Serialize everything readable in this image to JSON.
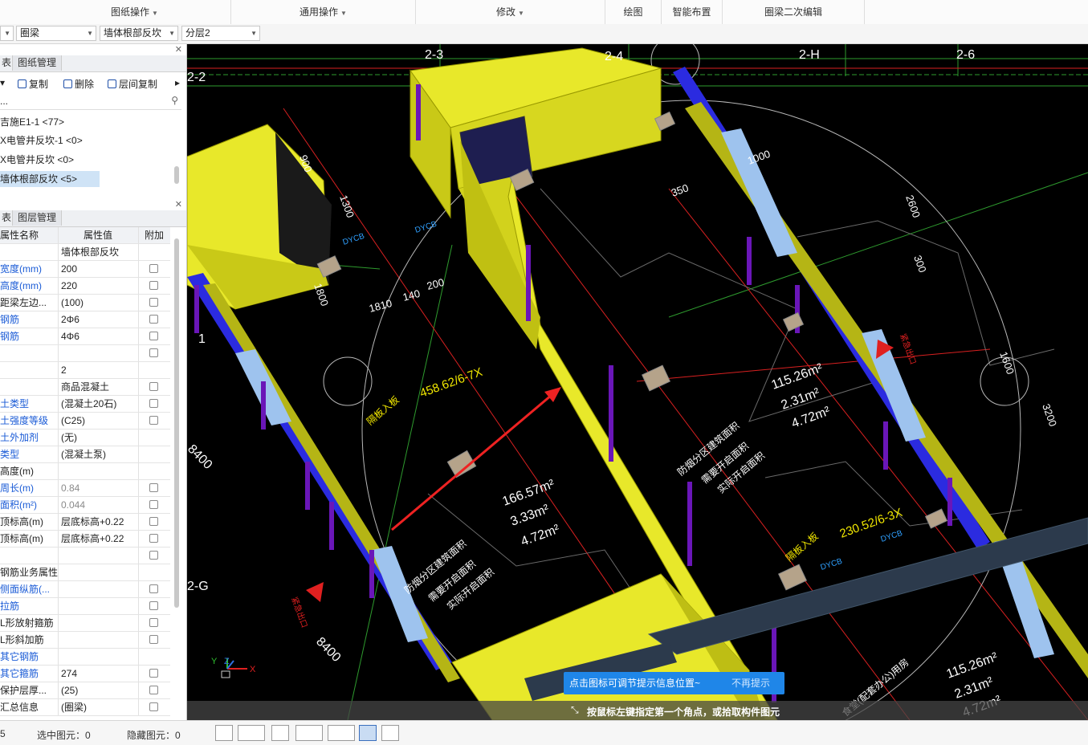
{
  "ribbon": {
    "groups": [
      {
        "label": "图纸操作",
        "dropdown": true
      },
      {
        "label": "通用操作",
        "dropdown": true
      },
      {
        "label": "修改",
        "dropdown": true
      },
      {
        "label": "绘图",
        "dropdown": false
      },
      {
        "label": "智能布置",
        "dropdown": false
      },
      {
        "label": "圈梁二次编辑",
        "dropdown": false
      }
    ]
  },
  "selectors": {
    "element_type": "圈梁",
    "element_name": "墙体根部反坎",
    "layer": "分层2"
  },
  "upper_panel": {
    "tab_left_partial": "表",
    "tab_drawing": "图纸管理",
    "toolbar": {
      "copy": "复制",
      "delete": "删除",
      "floor_copy": "层间复制"
    },
    "filter_placeholder": "...",
    "items": [
      {
        "label": "结施E1-1 <77>",
        "visible": "吉施E1-1 <77>"
      },
      {
        "label": "X电管井反坎-1 <0>",
        "visible": "X电管井反坎-1 <0>"
      },
      {
        "label": "X电管井反坎 <0>",
        "visible": "X电管井反坎 <0>"
      },
      {
        "label": "墙体根部反坎 <5>",
        "visible": "墙体根部反坎 <5>"
      }
    ]
  },
  "lower_panel": {
    "tab_left_partial": "表",
    "tab_layers": "图层管理",
    "header": {
      "name": "属性名称",
      "value": "属性值",
      "extra": "附加"
    },
    "rows": [
      {
        "name": "",
        "value": "墙体根部反坎",
        "cb": false,
        "style": ""
      },
      {
        "name": "宽度(mm)",
        "value": "200",
        "cb": true,
        "style": "blue"
      },
      {
        "name": "高度(mm)",
        "value": "220",
        "cb": true,
        "style": "blue"
      },
      {
        "name": "距梁左边...",
        "value": "(100)",
        "cb": true,
        "style": ""
      },
      {
        "name": "钢筋",
        "value": "2Φ6",
        "cb": true,
        "style": "blue"
      },
      {
        "name": "钢筋",
        "value": "4Φ6",
        "cb": true,
        "style": "blue"
      },
      {
        "name": "",
        "value": "",
        "cb": true,
        "style": ""
      },
      {
        "name": "",
        "value": "2",
        "cb": false,
        "style": ""
      },
      {
        "name": "",
        "value": "商品混凝土",
        "cb": true,
        "style": ""
      },
      {
        "name": "土类型",
        "value": "(混凝土20石)",
        "cb": true,
        "style": "blue"
      },
      {
        "name": "土强度等级",
        "value": "(C25)",
        "cb": true,
        "style": "blue"
      },
      {
        "name": "土外加剂",
        "value": "(无)",
        "cb": false,
        "style": "blue"
      },
      {
        "name": "类型",
        "value": "(混凝土泵)",
        "cb": false,
        "style": "blue"
      },
      {
        "name": "高度(m)",
        "value": "",
        "cb": false,
        "style": ""
      },
      {
        "name": "周长(m)",
        "value": "0.84",
        "cb": true,
        "style": "blue",
        "valstyle": "gray"
      },
      {
        "name": "面积(m²)",
        "value": "0.044",
        "cb": true,
        "style": "blue",
        "valstyle": "gray"
      },
      {
        "name": "顶标高(m)",
        "value": "层底标高+0.22",
        "cb": true,
        "style": ""
      },
      {
        "name": "顶标高(m)",
        "value": "层底标高+0.22",
        "cb": true,
        "style": ""
      },
      {
        "name": "",
        "value": "",
        "cb": true,
        "style": ""
      },
      {
        "name": "钢筋业务属性",
        "value": "",
        "cb": false,
        "style": ""
      },
      {
        "name": "侧面纵筋(...",
        "value": "",
        "cb": true,
        "style": "blue"
      },
      {
        "name": "拉筋",
        "value": "",
        "cb": true,
        "style": "blue"
      },
      {
        "name": "L形放射箍筋",
        "value": "",
        "cb": true,
        "style": ""
      },
      {
        "name": "L形斜加筋",
        "value": "",
        "cb": true,
        "style": ""
      },
      {
        "name": "其它钢筋",
        "value": "",
        "cb": false,
        "style": "blue"
      },
      {
        "name": "其它箍筋",
        "value": "274",
        "cb": true,
        "style": "blue"
      },
      {
        "name": "保护层厚...",
        "value": "(25)",
        "cb": true,
        "style": ""
      },
      {
        "name": "汇总信息",
        "value": "(圈梁)",
        "cb": true,
        "style": ""
      }
    ]
  },
  "viewport": {
    "axis_labels": [
      "2-3",
      "2-4",
      "2-H",
      "2-6",
      "2-2",
      "2-G",
      "1"
    ],
    "dims": [
      "1800",
      "1810",
      "140",
      "200",
      "1300",
      "1600",
      "1000",
      "350",
      "2600",
      "8400",
      "3200",
      "900",
      "300"
    ],
    "room_a": {
      "areas": [
        "166.57m²",
        "3.33m²",
        "4.72m²"
      ],
      "labels": [
        "防烟分区建筑面积",
        "需要开启面积",
        "实际开启面积"
      ]
    },
    "room_b": {
      "areas": [
        "115.26m²",
        "2.31m²",
        "4.72m²"
      ],
      "labels": [
        "防烟分区建筑面积",
        "需要开启面积",
        "实际开启面积"
      ]
    },
    "room_c": {
      "areas": [
        "115.26m²",
        "2.31m²",
        "4.72m²"
      ],
      "labels": [
        "食堂(配套办公)用房",
        "需要开启面积",
        "实际开启面积"
      ]
    },
    "zone_tags": [
      "458.62/6-7X",
      "230.52/6-3X"
    ],
    "vent_labels": [
      "隔板入板",
      "隔板入板"
    ],
    "code_labels": [
      "DYCB",
      "DYCB",
      "DYCB",
      "DYCB"
    ],
    "arrow_label": "紧急出口",
    "tip": {
      "text": "点击图标可调节提示信息位置~",
      "dismiss": "不再提示"
    },
    "hint": "按鼠标左键指定第一个角点，或拾取构件图元",
    "axes": {
      "x": "X",
      "y": "Y",
      "z": "Z"
    }
  },
  "status": {
    "count_prefix": "5",
    "selected": "选中图元：0",
    "hidden": "隐藏图元：0"
  },
  "colors": {
    "wall_yellow": "#e8e82a",
    "beam_blue": "#2b2be0",
    "post_purple": "#6a16b8",
    "tip_blue": "#1f86e8",
    "grid_green": "#2e9b2e",
    "red_line": "#e02020"
  }
}
